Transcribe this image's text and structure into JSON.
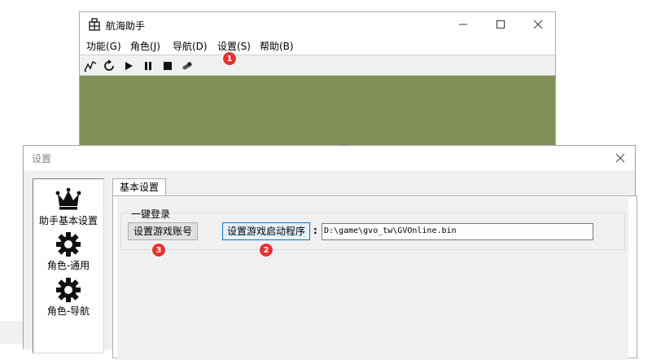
{
  "main_window": {
    "title": "航海助手",
    "menu": [
      {
        "label": "功能(G)"
      },
      {
        "label": "角色(J)"
      },
      {
        "label": "导航(D)"
      },
      {
        "label": "设置(S)"
      },
      {
        "label": "帮助(B)"
      }
    ],
    "toolbar": [
      "route-icon",
      "refresh-icon",
      "play-icon",
      "pause-icon",
      "stop-icon",
      "telescope-icon"
    ],
    "map_color": "#829156"
  },
  "settings_window": {
    "title": "设置",
    "side_items": [
      {
        "label": "助手基本设置",
        "icon": "crown-icon"
      },
      {
        "label": "角色-通用",
        "icon": "gear-icon"
      },
      {
        "label": "角色-导航",
        "icon": "gear-icon"
      }
    ],
    "tab_label": "基本设置",
    "group_title": "一键登录",
    "account_button": "设置游戏账号",
    "launch_button": "设置游戏启动程序",
    "colon": ":",
    "path_value": "D:\\game\\gvo_tw\\GVOnline.bin"
  },
  "annotations": {
    "badge_1": "1",
    "badge_2": "2",
    "badge_3": "3",
    "badge_color": "#e5322d"
  }
}
